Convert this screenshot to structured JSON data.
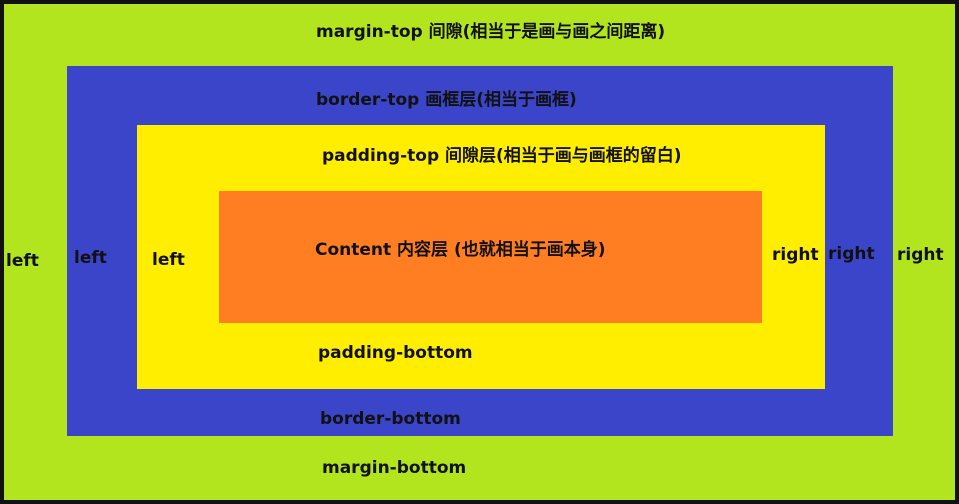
{
  "colors": {
    "margin": "#b3e51f",
    "border": "#3b45c9",
    "padding": "#ffee00",
    "content": "#ff7e22",
    "outline": "#111111",
    "text": "#111111"
  },
  "labels": {
    "margin_top": "margin-top 间隙(相当于是画与画之间距离)",
    "border_top": "border-top 画框层(相当于画框)",
    "padding_top": "padding-top 间隙层(相当于画与画框的留白)",
    "content": "Content 内容层  (也就相当于画本身)",
    "padding_bottom": "padding-bottom",
    "border_bottom": "border-bottom",
    "margin_bottom": "margin-bottom",
    "margin_left": "left",
    "border_left": "left",
    "padding_left": "left",
    "padding_right": "right",
    "border_right": "right",
    "margin_right": "right"
  }
}
